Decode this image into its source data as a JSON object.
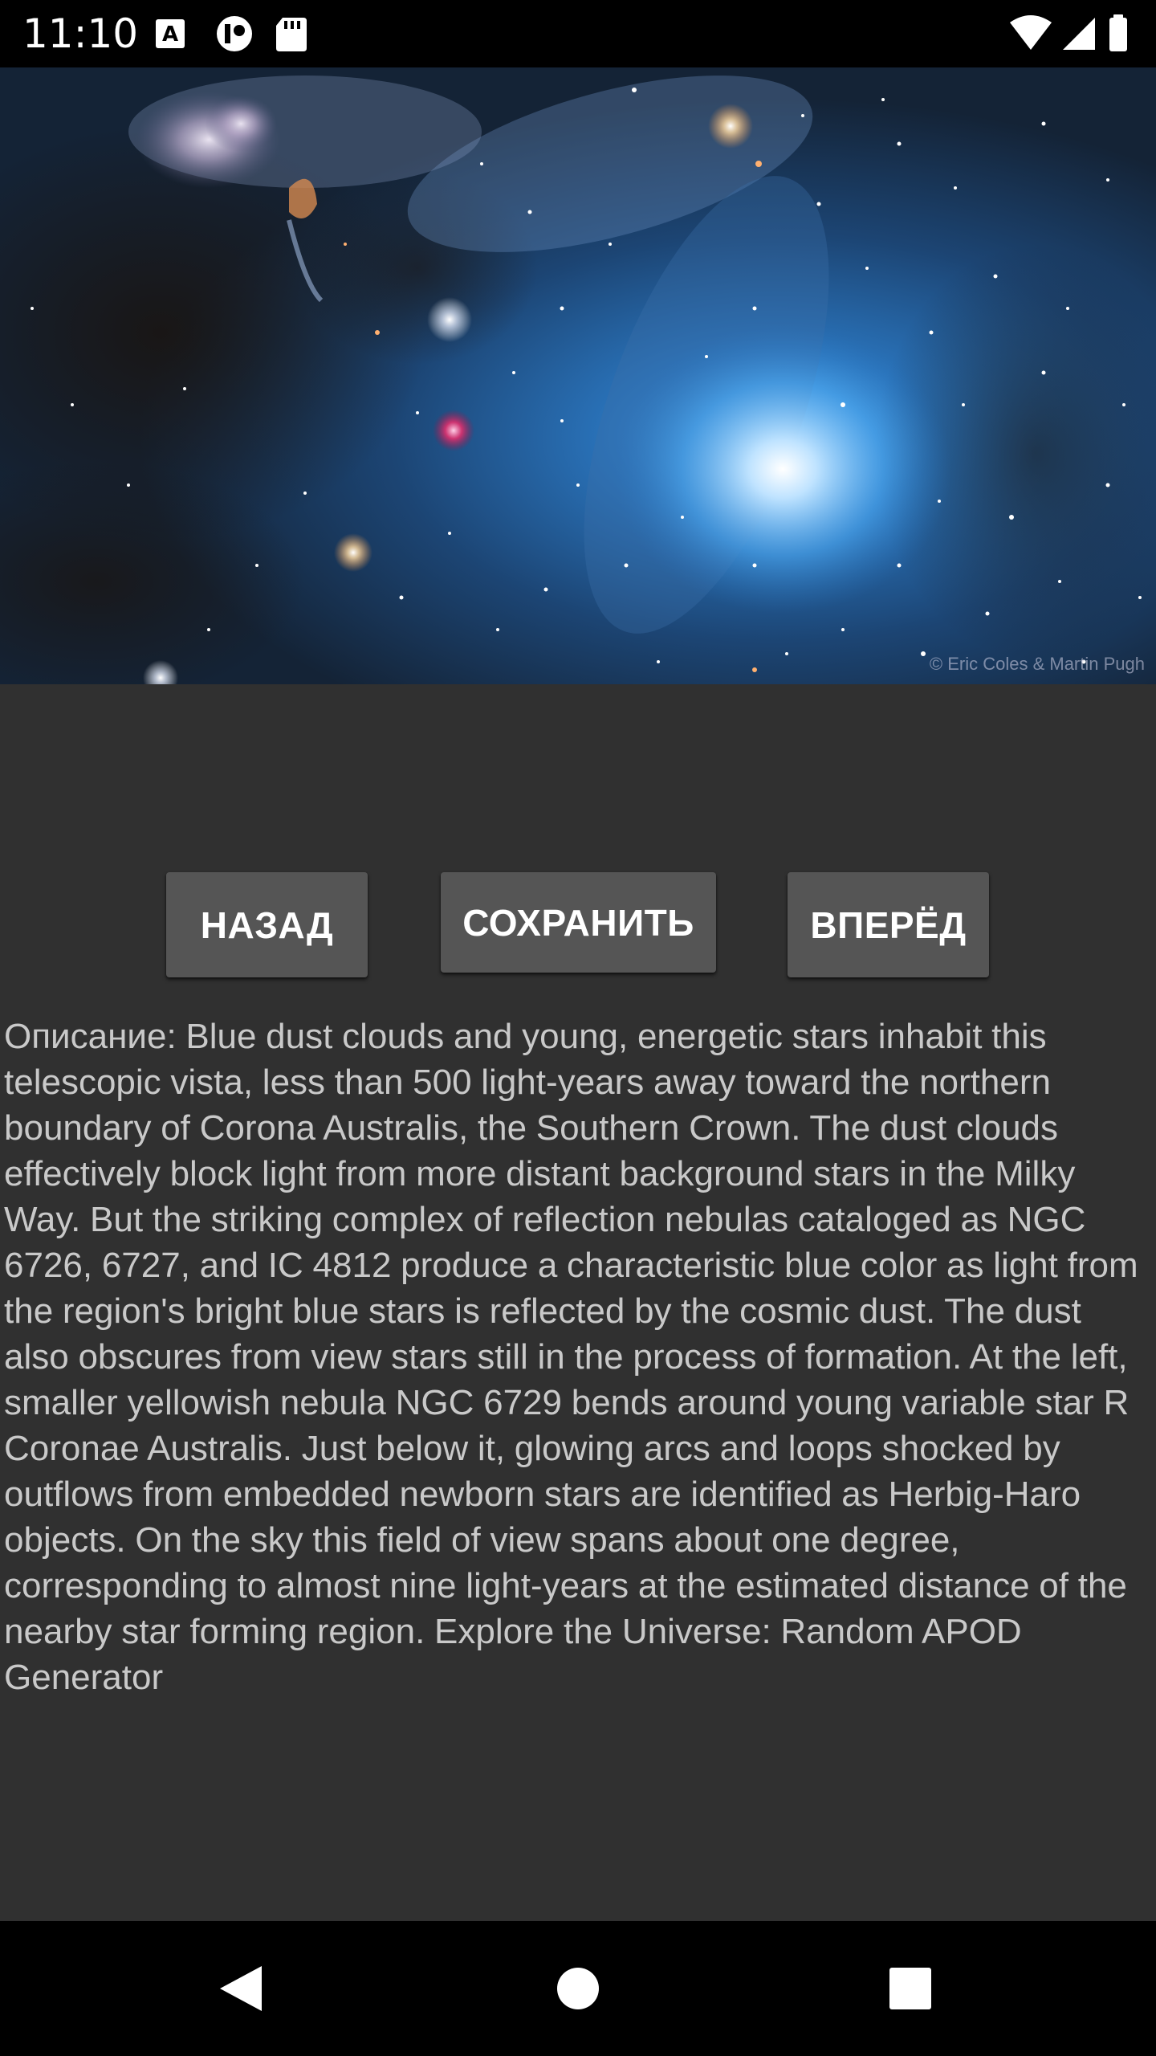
{
  "status_bar": {
    "time": "11:10",
    "notification_icons": [
      "a-translate-icon",
      "app-notification-icon",
      "sd-card-icon"
    ],
    "system_icons": [
      "wifi-icon",
      "signal-icon",
      "battery-icon"
    ]
  },
  "apod": {
    "image_alt": "nebula-image",
    "credit": "© Eric Coles & Martin Pugh"
  },
  "actions": {
    "back_label": "НАЗАД",
    "save_label": "СОХРАНИТЬ",
    "next_label": "ВПЕРЁД"
  },
  "description": {
    "text": "Описание: Blue dust clouds and young, energetic stars inhabit this telescopic vista, less than 500 light-years away toward the northern boundary of Corona Australis, the Southern Crown. The dust clouds effectively block light from more distant background stars in the Milky Way. But the striking complex of reflection nebulas cataloged as NGC 6726, 6727, and IC 4812 produce a characteristic blue color as light from the region's bright blue stars is reflected by the cosmic dust. The dust also obscures from view stars still in the process of formation. At the left, smaller yellowish nebula NGC 6729 bends around young variable star R Coronae Australis. Just below it, glowing arcs and loops shocked by outflows from embedded newborn stars are identified as Herbig-Haro objects. On the sky this field of view spans about one degree, corresponding to almost nine light-years at the estimated distance of the nearby star forming region.   Explore the Universe: Random APOD Generator"
  },
  "nav_bar": {
    "items": [
      "back-icon",
      "home-icon",
      "recents-icon"
    ]
  },
  "colors": {
    "background": "#303030",
    "button": "#555555",
    "text": "#c9c9c9",
    "bars": "#000000"
  }
}
